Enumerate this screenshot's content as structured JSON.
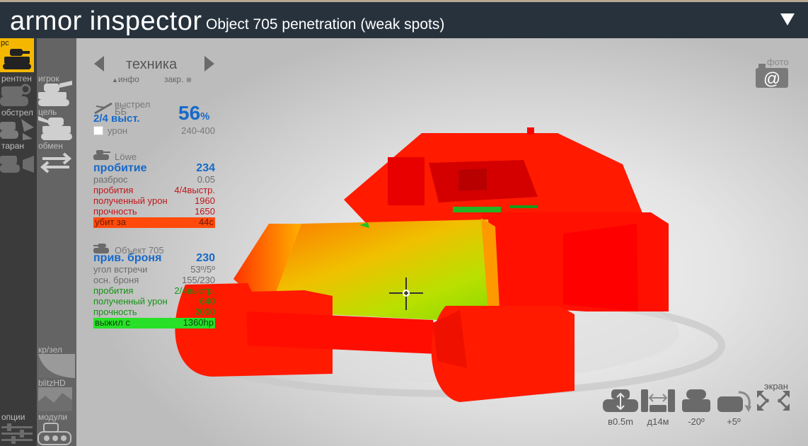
{
  "header": {
    "title": "armor inspector",
    "subtitle": "Object 705 penetration (weak spots)"
  },
  "left_sidebar": {
    "items": [
      {
        "label": "рс"
      },
      {
        "label": "рентген"
      },
      {
        "label": "обстрел"
      },
      {
        "label": "таран"
      },
      {
        "label": "опции"
      }
    ]
  },
  "right_sidebar": {
    "items": [
      {
        "label": "игрок"
      },
      {
        "label": "цель"
      },
      {
        "label": "обмен"
      },
      {
        "label": "кр/зел"
      },
      {
        "label": "blitzHD"
      },
      {
        "label": "модули"
      }
    ]
  },
  "panel": {
    "nav_label": "техника",
    "info_label": "инфо",
    "pin_label": "закр.",
    "shot": {
      "label": "выстрел",
      "ammo": "ББ",
      "hits": "2/4 выст.",
      "percent": "56",
      "percent_unit": "%",
      "damage_label": "урон",
      "damage_range": "240-400"
    },
    "attacker": {
      "name": "Löwe",
      "rows": [
        {
          "label": "пробитие",
          "value": "234",
          "style": "blue"
        },
        {
          "label": "разброс",
          "value": "0.05",
          "style": "grey"
        },
        {
          "label": "пробития",
          "value": "4/4выстр.",
          "style": "red"
        },
        {
          "label": "полученный урон",
          "value": "1960",
          "style": "red"
        },
        {
          "label": "прочность",
          "value": "1650",
          "style": "red"
        },
        {
          "label": "убит за",
          "value": "44с",
          "style": "bar-red"
        }
      ]
    },
    "target": {
      "name": "Объект 705",
      "rows": [
        {
          "label": "прив. броня",
          "value": "230",
          "style": "blue"
        },
        {
          "label": "угол встречи",
          "value": "53º/5º",
          "style": "grey"
        },
        {
          "label": "осн. броня",
          "value": "155/230",
          "style": "grey"
        },
        {
          "label": "пробития",
          "value": "2/4выстр.",
          "style": "green"
        },
        {
          "label": "полученный урон",
          "value": "640",
          "style": "green"
        },
        {
          "label": "прочность",
          "value": "2000",
          "style": "green"
        },
        {
          "label": "выжил с",
          "value": "1360hp",
          "style": "bar-green"
        }
      ]
    }
  },
  "photo": {
    "label": "фото"
  },
  "screen": {
    "label": "экран"
  },
  "controls": [
    {
      "label": "в0.5m"
    },
    {
      "label": "д14м"
    },
    {
      "label": "-20º"
    },
    {
      "label": "+5º"
    }
  ],
  "colors": {
    "header_bg": "#27323d",
    "highlight": "#f5b800",
    "armor_weak": "#ff0000",
    "armor_pen": "#8fe000",
    "accent_blue": "#1769c9"
  }
}
